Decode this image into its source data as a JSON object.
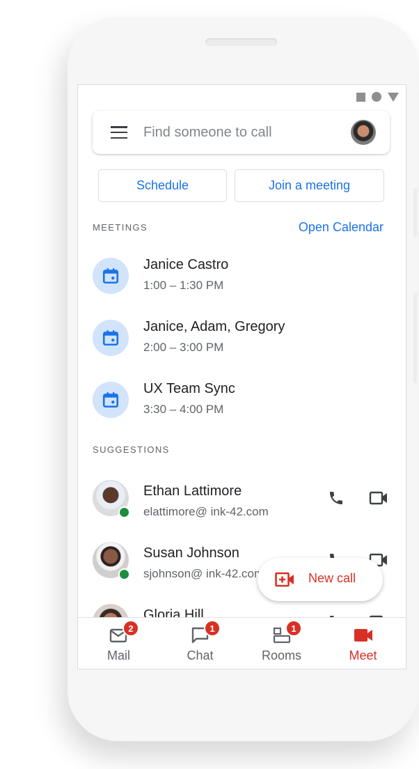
{
  "status_bar": {
    "icons": [
      "square-icon",
      "circle-icon",
      "triangle-icon"
    ]
  },
  "search": {
    "placeholder": "Find someone to call",
    "menu_icon": "menu-icon",
    "avatar": "user-avatar"
  },
  "actions": {
    "schedule_label": "Schedule",
    "join_label": "Join a meeting"
  },
  "meetings": {
    "label": "MEETINGS",
    "open_calendar_label": "Open Calendar",
    "items": [
      {
        "title": "Janice Castro",
        "time": "1:00 – 1:30 PM",
        "icon": "calendar-icon"
      },
      {
        "title": "Janice, Adam, Gregory",
        "time": "2:00 – 3:00 PM",
        "icon": "calendar-icon"
      },
      {
        "title": "UX Team Sync",
        "time": "3:30 – 4:00 PM",
        "icon": "calendar-icon"
      }
    ]
  },
  "suggestions": {
    "label": "SUGGESTIONS",
    "items": [
      {
        "name": "Ethan Lattimore",
        "email": "elattimore@ ink-42.com",
        "online": true
      },
      {
        "name": "Susan Johnson",
        "email": "sjohnson@ ink-42.com",
        "online": true
      },
      {
        "name": "Gloria Hill",
        "email": "",
        "online": false
      }
    ]
  },
  "fab": {
    "label": "New call",
    "icon": "new-video-call-icon"
  },
  "bottom_nav": {
    "items": [
      {
        "label": "Mail",
        "badge": "2",
        "icon": "mail-icon",
        "active": false
      },
      {
        "label": "Chat",
        "badge": "1",
        "icon": "chat-icon",
        "active": false
      },
      {
        "label": "Rooms",
        "badge": "1",
        "icon": "rooms-icon",
        "active": false
      },
      {
        "label": "Meet",
        "badge": "",
        "icon": "meet-video-icon",
        "active": true
      }
    ]
  },
  "colors": {
    "accent_blue": "#1a73e8",
    "accent_red": "#d93025",
    "online_green": "#1e8e3e",
    "calendar_bg": "#d2e3fc"
  }
}
